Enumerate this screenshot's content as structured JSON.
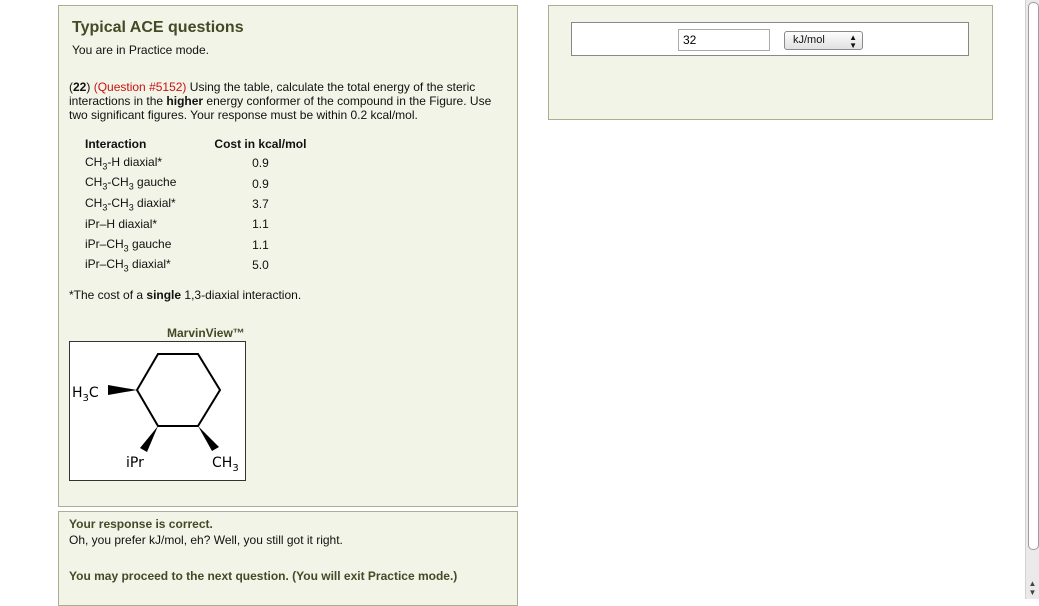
{
  "question": {
    "title": "Typical ACE questions",
    "mode": "You are in Practice mode.",
    "number": "22",
    "id_label": "(Question #5152)",
    "text_intro": "Using the table, calculate the total energy of the steric interactions in the",
    "text_emphasis": "higher",
    "text_rest": "energy conformer of the compound in the Figure. Use two significant figures. Your response must be within 0.2 kcal/mol.",
    "table": {
      "headers": [
        "Interaction",
        "Cost in kcal/mol"
      ],
      "rows": [
        {
          "interaction": "CH3–H diaxial*",
          "cost": "0.9"
        },
        {
          "interaction": "CH3–CH3 gauche",
          "cost": "0.9"
        },
        {
          "interaction": "CH3–CH3 diaxial*",
          "cost": "3.7"
        },
        {
          "interaction": "iPr–H diaxial*",
          "cost": "1.1"
        },
        {
          "interaction": "iPr–CH3 gauche",
          "cost": "1.1"
        },
        {
          "interaction": "iPr–CH3 diaxial*",
          "cost": "5.0"
        }
      ]
    },
    "note_prefix": "*The cost of a",
    "note_emphasis": "single",
    "note_suffix": "1,3-diaxial interaction.",
    "viewer_label": "MarvinView™",
    "molecule": {
      "label_h3c": "H3C",
      "label_ipr": "iPr",
      "label_ch3": "CH3"
    }
  },
  "answer": {
    "value": "32",
    "unit": "kJ/mol"
  },
  "feedback": {
    "correct": "Your response is correct.",
    "comment": "Oh, you prefer kJ/mol, eh? Well, you still got it right.",
    "proceed": "You may proceed to the next question. (You will exit Practice mode.)"
  },
  "colors": {
    "panel_bg": "#f1f4e6",
    "heading": "#444a26",
    "question_id": "#cc1111"
  }
}
